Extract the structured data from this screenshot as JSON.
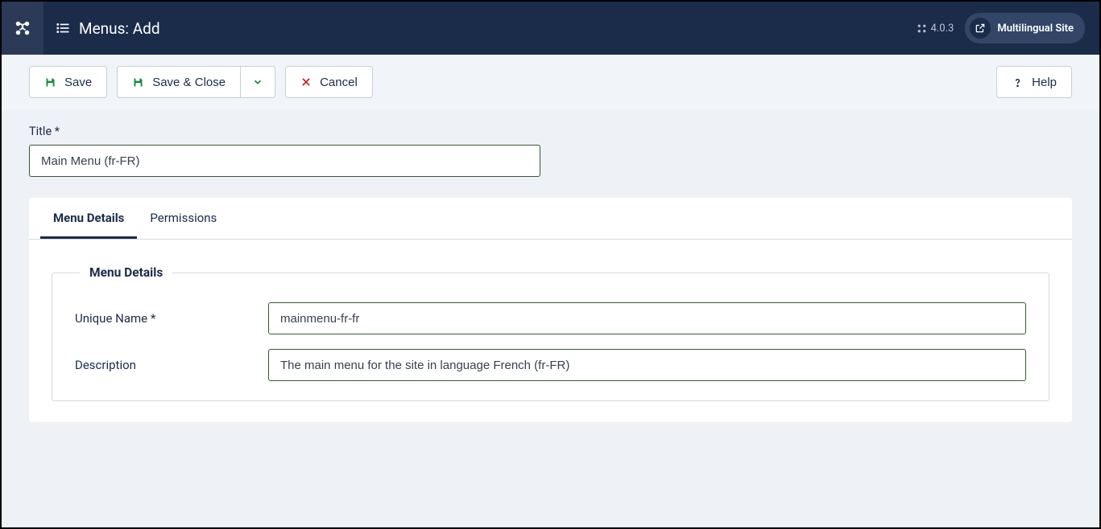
{
  "header": {
    "page_title": "Menus: Add",
    "version": "4.0.3",
    "site_button": "Multilingual Site"
  },
  "toolbar": {
    "save": "Save",
    "save_close": "Save & Close",
    "cancel": "Cancel",
    "help": "Help"
  },
  "form": {
    "title_label": "Title *",
    "title_value": "Main Menu (fr-FR)"
  },
  "tabs": {
    "menu_details": "Menu Details",
    "permissions": "Permissions"
  },
  "details": {
    "legend": "Menu Details",
    "unique_label": "Unique Name *",
    "unique_value": "mainmenu-fr-fr",
    "desc_label": "Description",
    "desc_value": "The main menu for the site in language French (fr-FR)"
  }
}
